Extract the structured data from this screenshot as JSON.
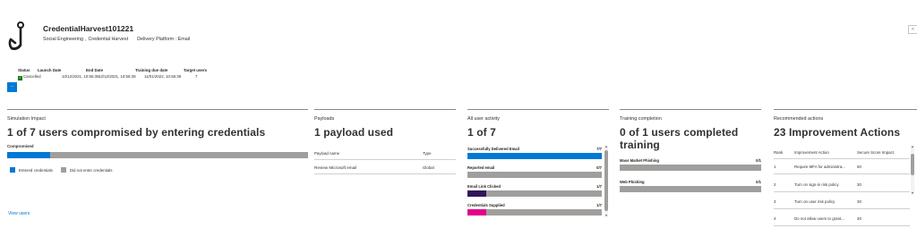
{
  "header": {
    "title": "CredentialHarvest101221",
    "technique": "Social Engineering",
    "technique_detail": "Credential Harvest",
    "delivery": "Delivery Platform : Email"
  },
  "details": {
    "columns": [
      "Status",
      "Launch Date",
      "End Date",
      "Training due date",
      "Target users"
    ],
    "status": "Cancelled",
    "launch_date": "10/12/2021, 10:55:39",
    "end_date": "12/12/2021, 10:55:39",
    "training_due": "11/01/2022, 10:55:39",
    "target_users": "7",
    "more_label": "..."
  },
  "simulation_impact": {
    "title": "Simulation Impact",
    "headline": "1 of 7 users compromised by entering credentials",
    "bar_label": "Compromised",
    "entered": 1,
    "not_entered": 6,
    "legend": [
      "Entered credentials",
      "Did not enter credentials"
    ],
    "view_users": "View users"
  },
  "payloads": {
    "title": "Payloads",
    "headline": "1 payload used",
    "col_name": "Payload name",
    "col_type": "Type",
    "rows": [
      {
        "name": "Review Microsoft email",
        "type": "Global"
      }
    ]
  },
  "user_activity": {
    "title": "All user activity",
    "headline": "1 of 7",
    "items": [
      {
        "label": "Successfully Delivered Email",
        "value": "7/7",
        "fraction": 1.0,
        "color": "#0078d4"
      },
      {
        "label": "Reported email",
        "value": "0/7",
        "fraction": 0,
        "color": "#0078d4"
      },
      {
        "label": "Email Link Clicked",
        "value": "1/7",
        "fraction": 0.143,
        "color": "#32145a"
      },
      {
        "label": "Credentials Supplied",
        "value": "1/7",
        "fraction": 0.143,
        "color": "#e3008c"
      }
    ]
  },
  "training": {
    "title": "Training completion",
    "headline_line1": "0 of 1 users completed",
    "headline_line2": "training",
    "items": [
      {
        "label": "Mass Market Phishing",
        "value": "0/1",
        "fraction": 0
      },
      {
        "label": "Web Phishing",
        "value": "0/1",
        "fraction": 0
      }
    ]
  },
  "recommended": {
    "title": "Recommended actions",
    "headline": "23 Improvement Actions",
    "col_rank": "Rank",
    "col_action": "Improvement Action",
    "col_impact": "Secure Score Impact",
    "rows": [
      {
        "rank": "1",
        "action": "Require MFA for administra...",
        "impact": "50"
      },
      {
        "rank": "2",
        "action": "Turn on sign-in risk policy",
        "impact": "30"
      },
      {
        "rank": "3",
        "action": "Turn on user risk policy",
        "impact": "30"
      },
      {
        "rank": "4",
        "action": "Do not allow users to grant...",
        "impact": "30"
      }
    ]
  },
  "colors": {
    "accent": "#0078d4",
    "gray_bar": "#a19f9d",
    "status_green": "#107c10"
  }
}
